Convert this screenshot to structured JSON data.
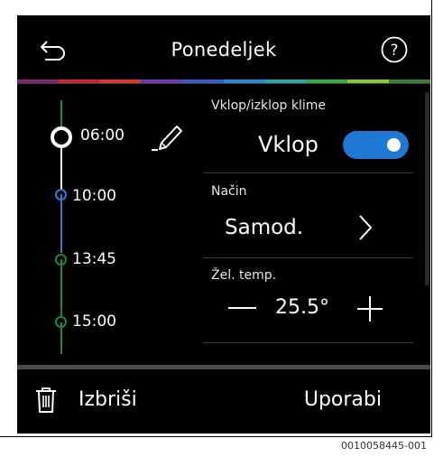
{
  "header": {
    "title": "Ponedeljek"
  },
  "colors": {
    "accent": "#1e78d4",
    "timeline_green": "#1c8a3c",
    "timeline_blue": "#2b7fd0",
    "background": "#000000"
  },
  "rainbow": [
    "#7a2a6a",
    "#c0283a",
    "#d83a2a",
    "#6a3aa8",
    "#3a5ad0",
    "#2a8ad0",
    "#2aa8a0",
    "#3aa83a",
    "#8ac83a",
    "#3a7a3a"
  ],
  "icons": {
    "back": "back-arrow-icon",
    "help": "help-icon",
    "edit": "pencil-icon",
    "next": "chevron-right-icon",
    "decrease": "minus-icon",
    "increase": "plus-icon",
    "delete": "trash-icon"
  },
  "timeline": [
    {
      "time": "06:00",
      "state": "selected"
    },
    {
      "time": "10:00",
      "state": "blue"
    },
    {
      "time": "13:45",
      "state": "green"
    },
    {
      "time": "15:00",
      "state": "green"
    }
  ],
  "settings": {
    "climate_label": "Vklop/izklop klime",
    "climate_value": "Vklop",
    "climate_on": true,
    "mode_label": "Način",
    "mode_value": "Samod.",
    "temp_label": "Žel. temp.",
    "temp_value": "25.5°"
  },
  "footer": {
    "delete_label": "Izbriši",
    "apply_label": "Uporabi"
  },
  "image_id": "0010058445-001"
}
